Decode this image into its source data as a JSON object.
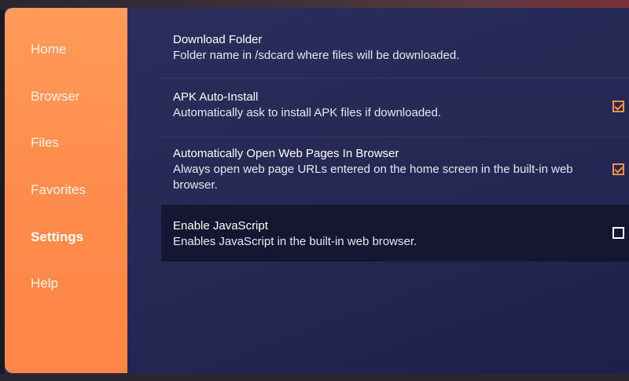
{
  "sidebar": {
    "items": [
      {
        "label": "Home"
      },
      {
        "label": "Browser"
      },
      {
        "label": "Files"
      },
      {
        "label": "Favorites"
      },
      {
        "label": "Settings",
        "active": true
      },
      {
        "label": "Help"
      }
    ]
  },
  "settings": [
    {
      "title": "Download Folder",
      "description": "Folder name in /sdcard where files will be downloaded."
    },
    {
      "title": "APK Auto-Install",
      "description": "Automatically ask to install APK files if downloaded.",
      "checked": true
    },
    {
      "title": "Automatically Open Web Pages In Browser",
      "description": "Always open web page URLs entered on the home screen in the built-in web browser.",
      "checked": true
    },
    {
      "title": "Enable JavaScript",
      "description": "Enables JavaScript in the built-in web browser.",
      "checked": false
    }
  ],
  "colors": {
    "accent": "#ff8c4c",
    "background": "#262a55",
    "focused_row": "#151631"
  }
}
